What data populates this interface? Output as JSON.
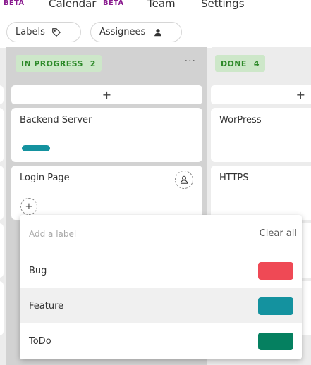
{
  "nav": {
    "beta_left": "BETA",
    "calendar": "Calendar",
    "beta_mid": "BETA",
    "team": "Team",
    "settings": "Settings"
  },
  "filters": {
    "labels": "Labels",
    "assignees": "Assignees"
  },
  "columns": {
    "inprogress": {
      "title": "IN PROGRESS",
      "count": "2",
      "menu": "···"
    },
    "done": {
      "title": "DONE",
      "count": "4"
    }
  },
  "cards": {
    "backend": "Backend Server",
    "login": "Login Page",
    "wordpress": "WorPress",
    "https": "HTTPS"
  },
  "add_symbol": "+",
  "dropdown": {
    "placeholder": "Add a label",
    "clear_all": "Clear all",
    "items": [
      {
        "label": "Bug",
        "color": "#ef4955"
      },
      {
        "label": "Feature",
        "color": "#14929f"
      },
      {
        "label": "ToDo",
        "color": "#058060"
      }
    ]
  },
  "colors": {
    "badge_bg": "#cde7c9",
    "badge_text": "#2e8a2a",
    "beta": "#8a1c8f",
    "feature_pill": "#14929f"
  }
}
